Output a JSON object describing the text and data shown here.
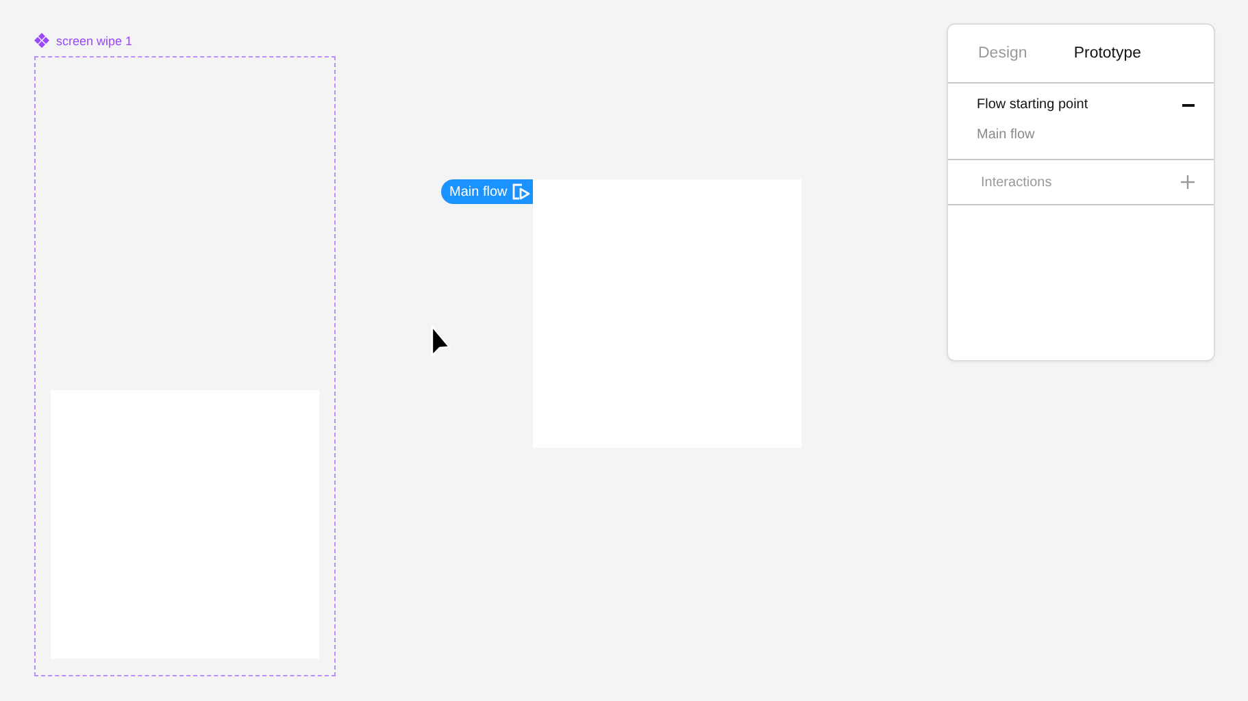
{
  "canvas": {
    "frame_label": "screen wipe 1",
    "flow_badge": "Main flow"
  },
  "panel": {
    "tabs": [
      {
        "label": "Design",
        "selected": false
      },
      {
        "label": "Prototype",
        "selected": true
      }
    ],
    "flow_section": {
      "title": "Flow starting point",
      "flow_name": "Main flow",
      "expanded": true
    },
    "interactions": {
      "title": "Interactions"
    }
  }
}
